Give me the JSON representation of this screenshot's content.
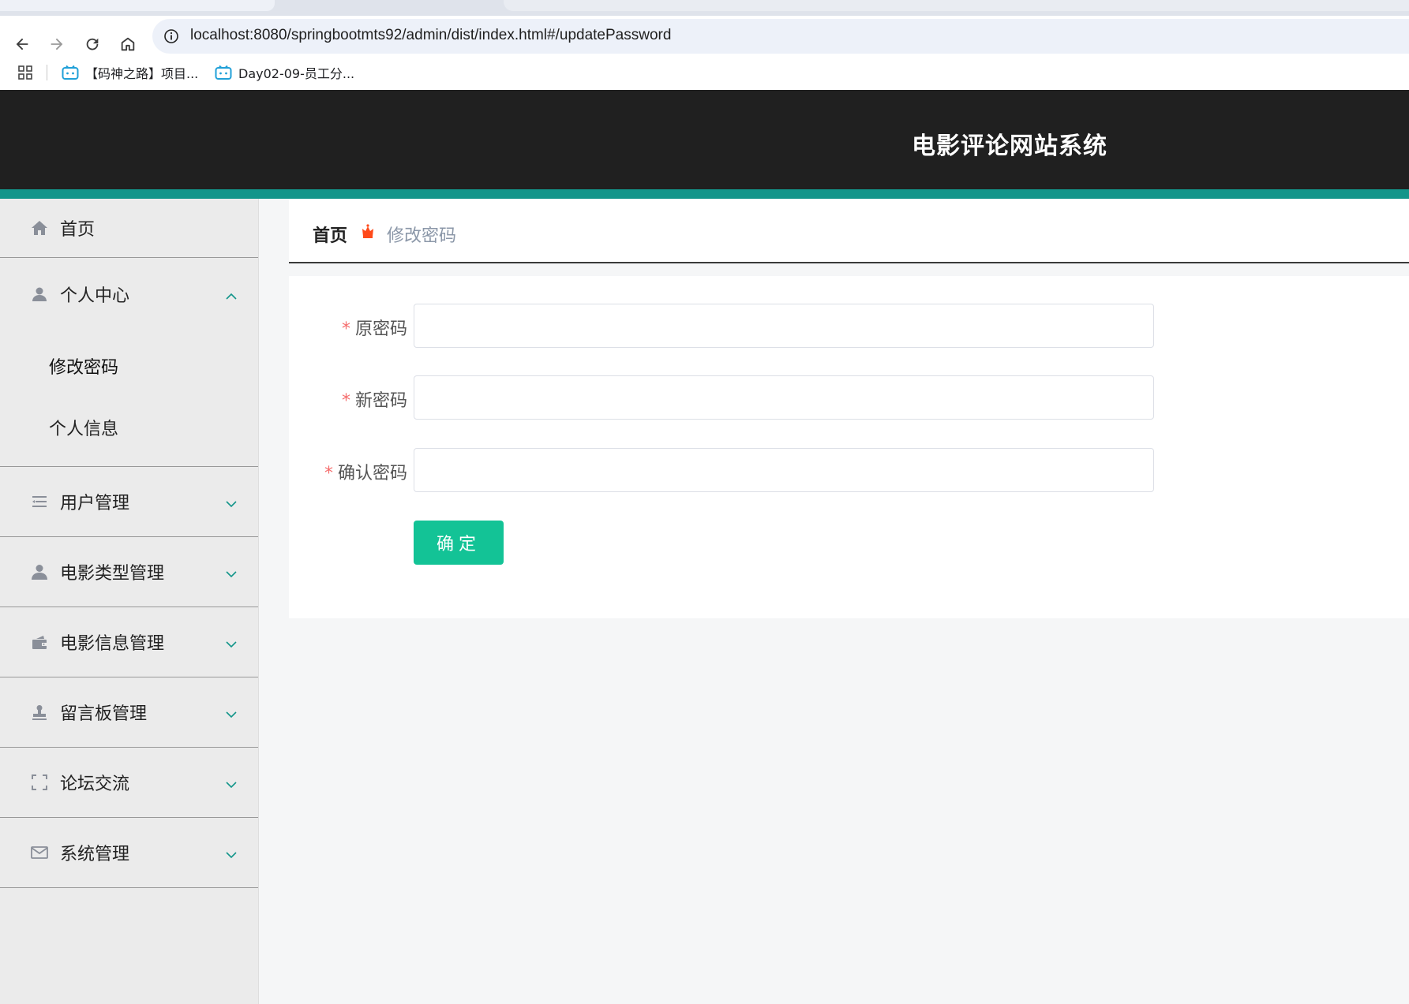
{
  "browser": {
    "url": "localhost:8080/springbootmts92/admin/dist/index.html#/updatePassword",
    "bookmarks": [
      {
        "label": "【码神之路】项目..."
      },
      {
        "label": "Day02-09-员工分..."
      }
    ]
  },
  "app": {
    "title": "电影评论网站系统",
    "accent_color": "#13958a",
    "header_color": "#202020",
    "button_color": "#13c396"
  },
  "sidebar": {
    "items": [
      {
        "label": "首页",
        "icon": "home-icon"
      },
      {
        "label": "个人中心",
        "icon": "user-icon",
        "expanded": true,
        "children": [
          {
            "label": "修改密码",
            "active": true
          },
          {
            "label": "个人信息"
          }
        ]
      },
      {
        "label": "用户管理",
        "icon": "list-icon"
      },
      {
        "label": "电影类型管理",
        "icon": "person-icon"
      },
      {
        "label": "电影信息管理",
        "icon": "wallet-icon"
      },
      {
        "label": "留言板管理",
        "icon": "stamp-icon"
      },
      {
        "label": "论坛交流",
        "icon": "fullscreen-icon"
      },
      {
        "label": "系统管理",
        "icon": "mail-icon"
      }
    ]
  },
  "breadcrumb": {
    "home": "首页",
    "current": "修改密码"
  },
  "form": {
    "required_mark": "*",
    "fields": [
      {
        "label": "原密码",
        "value": ""
      },
      {
        "label": "新密码",
        "value": ""
      },
      {
        "label": "确认密码",
        "value": ""
      }
    ],
    "submit_label": "确定"
  }
}
